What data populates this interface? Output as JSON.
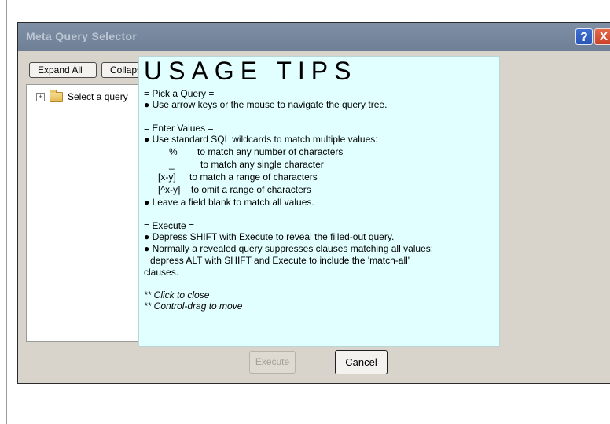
{
  "window": {
    "title": "Meta Query Selector",
    "help_label": "?",
    "close_label": "X"
  },
  "toolbar": {
    "expand_all": "Expand All",
    "collapse_all": "Collapse All"
  },
  "tree": {
    "root_label": "Select a query",
    "expander": "+"
  },
  "buttons": {
    "execute": "Execute",
    "cancel": "Cancel"
  },
  "tips": {
    "title": "USAGE TIPS",
    "pick_header": "= Pick a Query =",
    "pick_1": "● Use arrow keys or the mouse to navigate the query tree.",
    "enter_header": "= Enter Values =",
    "enter_1": "● Use standard SQL wildcards to match multiple values:",
    "wild_1_sym": "%",
    "wild_1_text": "to match any number of characters",
    "wild_2_sym": "_",
    "wild_2_text": "to match any single character",
    "wild_3_sym": "[x-y]",
    "wild_3_text": "to match a range of characters",
    "wild_4_sym": "[^x-y]",
    "wild_4_text": "to omit a range of characters",
    "enter_2": "● Leave a field blank to match all values.",
    "exec_header": "= Execute =",
    "exec_1": "● Depress SHIFT with Execute to reveal the filled-out query.",
    "exec_2a": "● Normally a revealed query suppresses clauses matching all values;",
    "exec_2b": "depress ALT with SHIFT and Execute to include the 'match-all'",
    "exec_2c": "clauses.",
    "note_1": "** Click to close",
    "note_2": "** Control-drag to move"
  },
  "colors": {
    "titlebar": "#7f90a6",
    "tips_background": "#e1ffff",
    "window_background": "#d8d4cb"
  }
}
